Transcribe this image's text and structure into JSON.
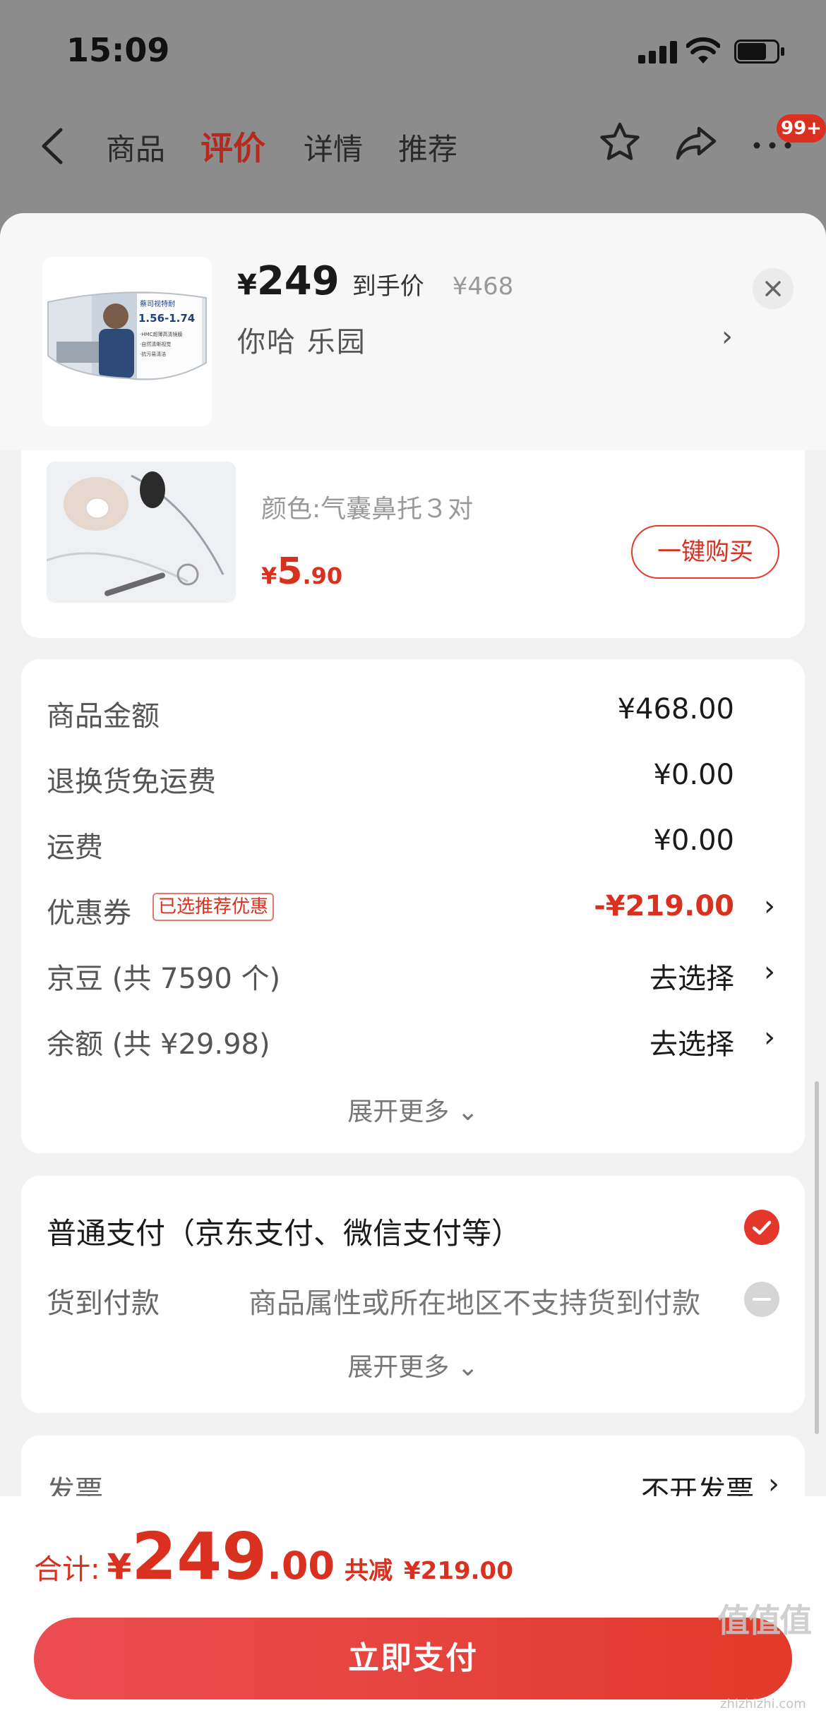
{
  "status_bar": {
    "time": "15:09"
  },
  "nav": {
    "tabs": [
      {
        "label": "商品"
      },
      {
        "label": "评价"
      },
      {
        "label": "详情"
      },
      {
        "label": "推荐"
      }
    ],
    "active_tab": "评价",
    "message_badge": "99+"
  },
  "product_header": {
    "currency": "¥",
    "price": "249",
    "price_label": "到手价",
    "original_price": "¥468",
    "spec": "你哈  乐园",
    "thumb_text": {
      "brand": "蔡司视特耐",
      "range": "1.56-1.74",
      "line1": "·HMC超薄高清镜膜",
      "line2": "·自然清晰视觉",
      "line3": "·抗污易清洁"
    }
  },
  "addon": {
    "spec": "颜色:气囊鼻托３对",
    "price_yen": "¥",
    "price_int": "5",
    "price_dec": ".90",
    "buy_label": "一键购买"
  },
  "summary": {
    "rows": [
      {
        "label": "商品金额",
        "value": "¥468.00"
      },
      {
        "label": "退换货免运费",
        "value": "¥0.00"
      },
      {
        "label": "运费",
        "value": "¥0.00"
      },
      {
        "label": "优惠券",
        "tag": "已选推荐优惠",
        "value": "-¥219.00"
      },
      {
        "label": "京豆 (共 7590 个)",
        "value": "去选择"
      },
      {
        "label": "余额 (共 ¥29.98)",
        "value": "去选择"
      }
    ],
    "expand_label": "展开更多 ⌄"
  },
  "payment": {
    "normal_label": "普通支付（京东支付、微信支付等）",
    "cod_label": "货到付款",
    "cod_note": "商品属性或所在地区不支持货到付款",
    "expand_label": "展开更多 ⌄"
  },
  "invoice": {
    "label": "发票",
    "value": "不开发票"
  },
  "bottom": {
    "total_label": "合计:",
    "total_yen": "¥",
    "total_int": "249",
    "total_dec": ".00",
    "saved_label": "共减",
    "saved_value": "¥219.00",
    "pay_button": "立即支付"
  },
  "watermark": {
    "main": "值值值",
    "sub": "zhizhizhi.com"
  },
  "colors": {
    "accent": "#d9301f",
    "button_gradient_start": "#ea4d52",
    "button_gradient_end": "#e23a2b",
    "overlay": "#8c8c8c"
  }
}
